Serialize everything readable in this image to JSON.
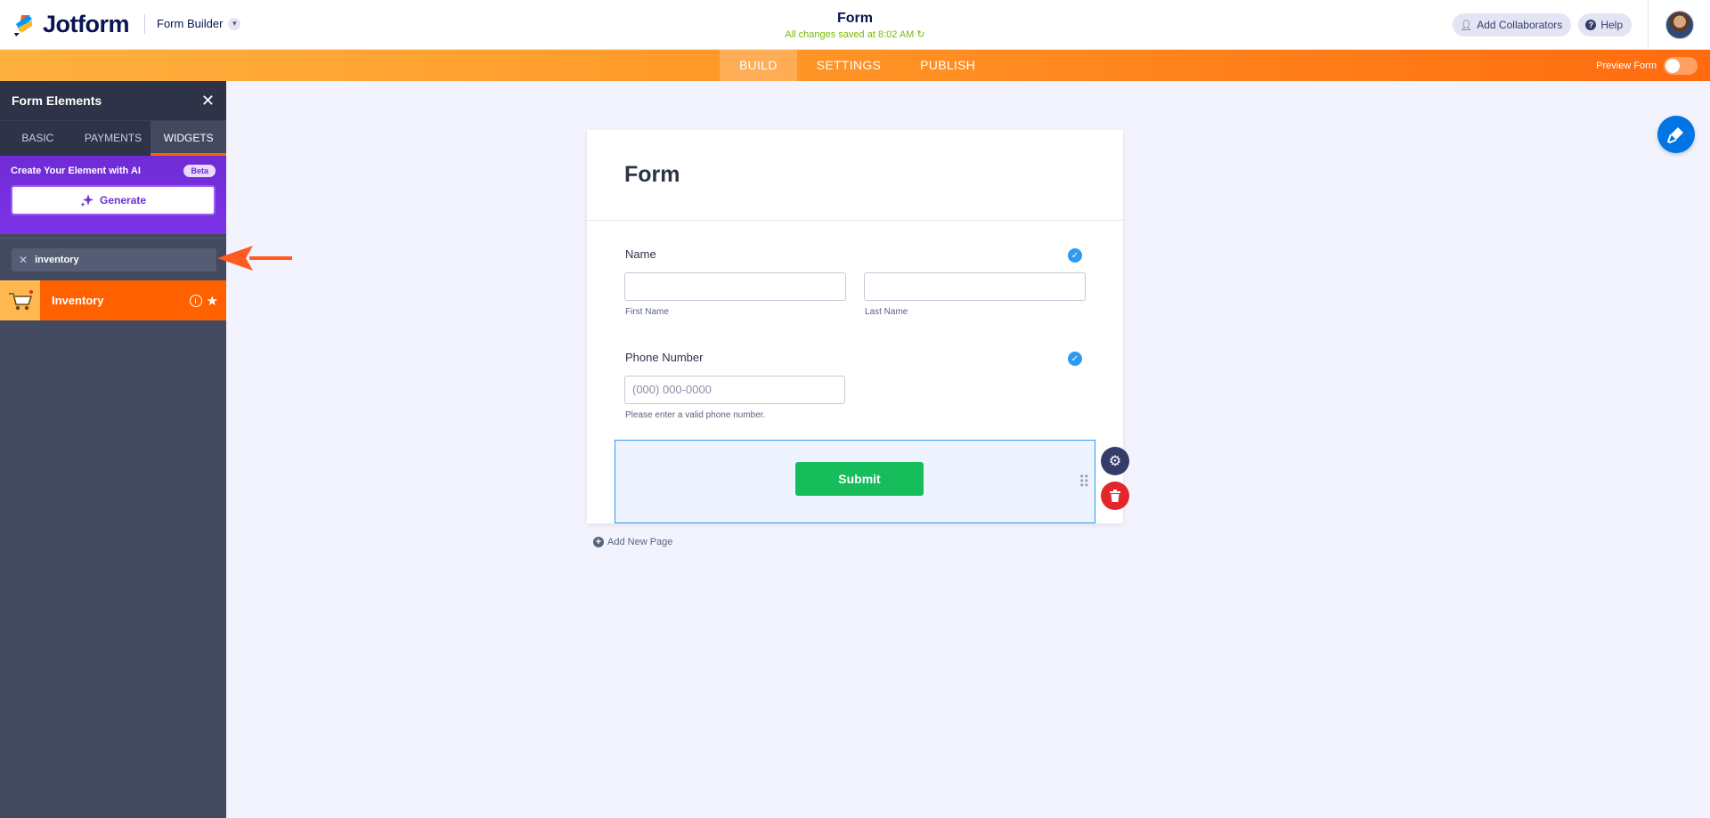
{
  "header": {
    "logo_text": "Jotform",
    "builder_menu": "Form Builder",
    "form_title": "Form",
    "save_status": "All changes saved at 8:02 AM",
    "add_collaborators": "Add Collaborators",
    "help": "Help"
  },
  "nav": {
    "tabs": [
      {
        "label": "BUILD",
        "active": true
      },
      {
        "label": "SETTINGS",
        "active": false
      },
      {
        "label": "PUBLISH",
        "active": false
      }
    ],
    "preview_label": "Preview Form"
  },
  "sidebar": {
    "title": "Form Elements",
    "tabs": [
      "BASIC",
      "PAYMENTS",
      "WIDGETS"
    ],
    "active_tab": "WIDGETS",
    "ai": {
      "title": "Create Your Element with AI",
      "badge": "Beta",
      "button": "Generate"
    },
    "search_value": "inventory",
    "results": [
      {
        "label": "Inventory",
        "icon": "shopping-cart-icon"
      }
    ]
  },
  "form": {
    "title": "Form",
    "name_field": {
      "label": "Name",
      "first_sublabel": "First Name",
      "last_sublabel": "Last Name"
    },
    "phone_field": {
      "label": "Phone Number",
      "placeholder": "(000) 000-0000",
      "sublabel": "Please enter a valid phone number."
    },
    "submit_label": "Submit",
    "add_page": "Add New Page"
  },
  "colors": {
    "accent_orange": "#ff6100",
    "sidebar_bg": "#434a60",
    "ai_purple": "#7c33e6",
    "submit_green": "#18bd5b",
    "check_blue": "#2e9af0"
  }
}
